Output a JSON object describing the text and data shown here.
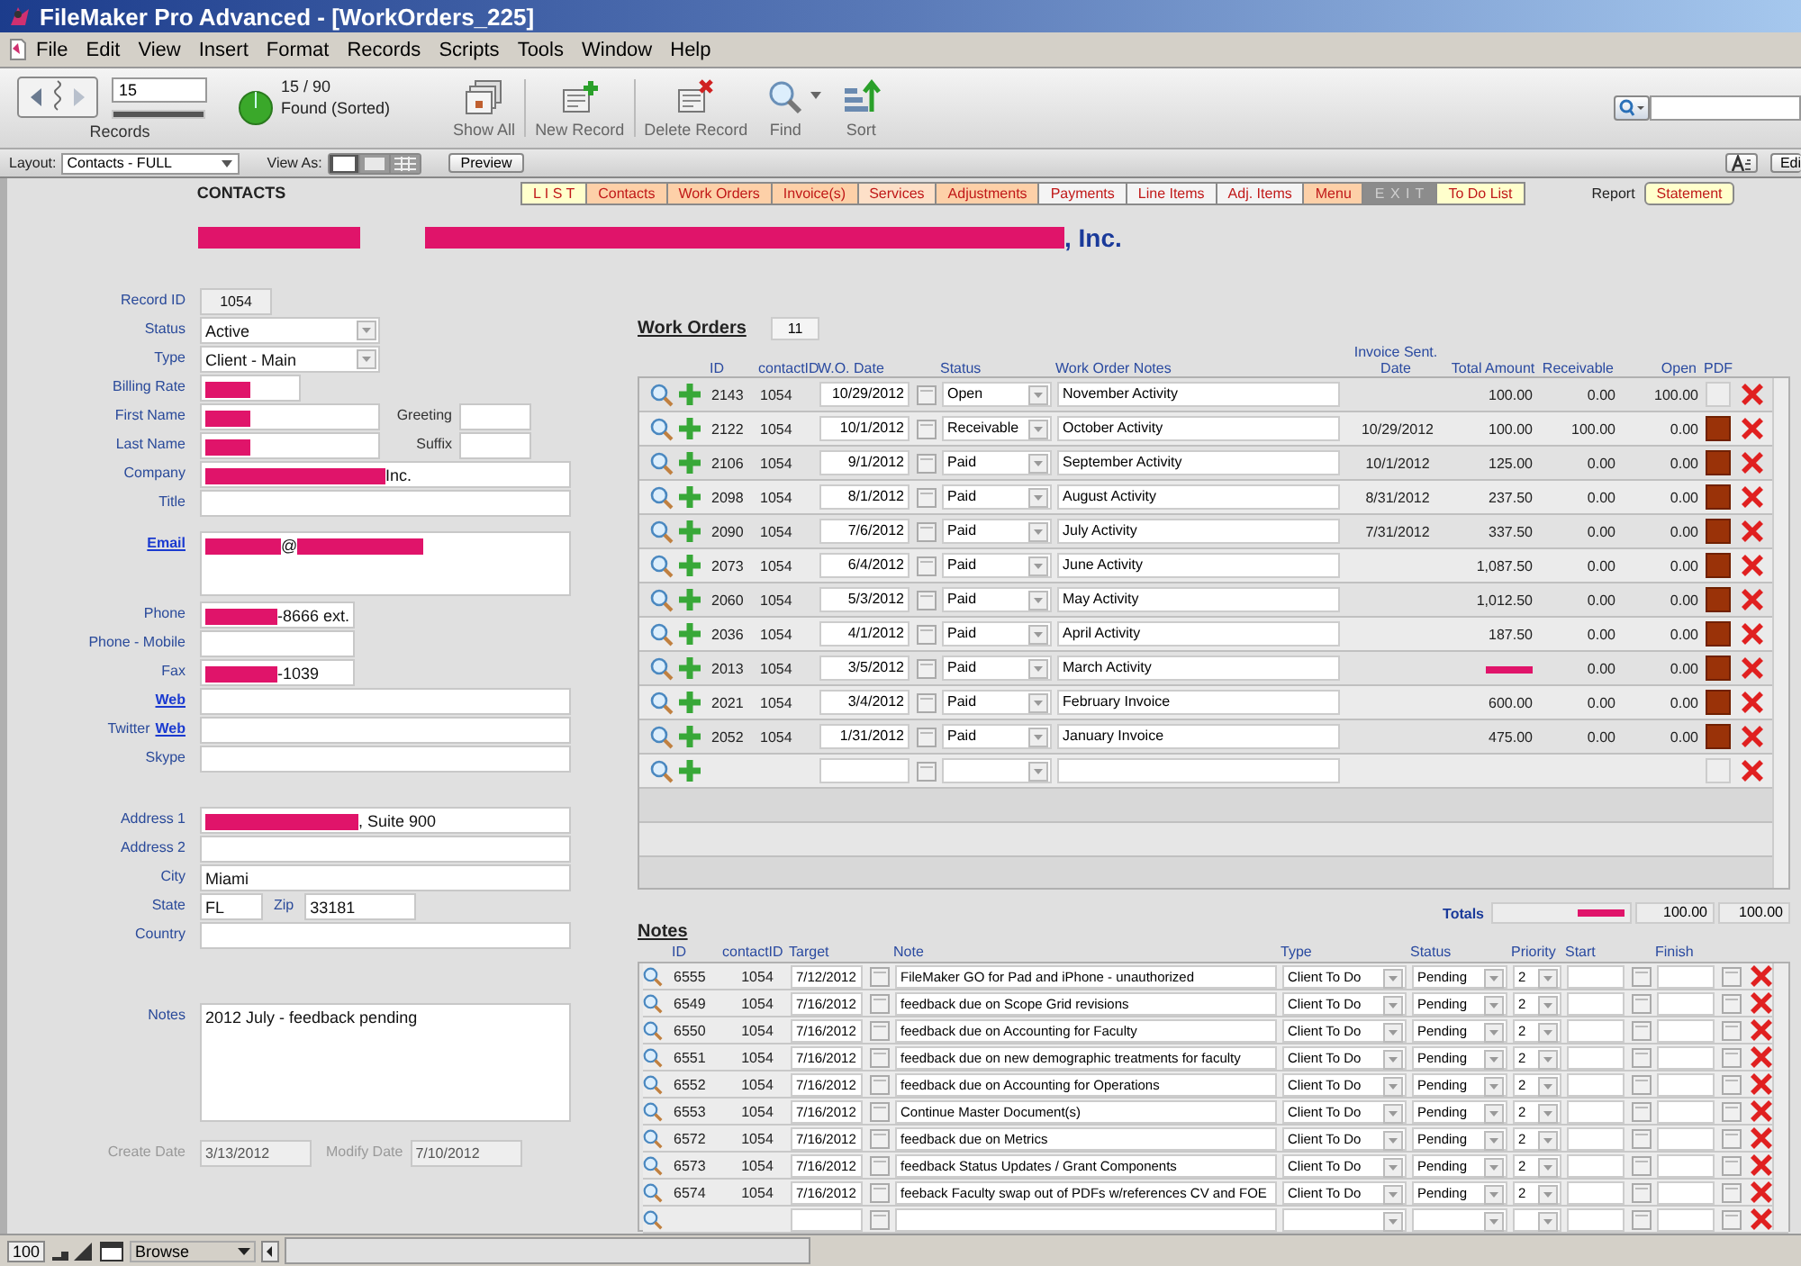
{
  "window": {
    "title": "FileMaker Pro Advanced - [WorkOrders_225]"
  },
  "menu": [
    "File",
    "Edit",
    "View",
    "Insert",
    "Format",
    "Records",
    "Scripts",
    "Tools",
    "Window",
    "Help"
  ],
  "toolbar": {
    "record_number": "15",
    "record_slider": {
      "level": 1
    },
    "records_label": "Records",
    "found_count": "15 / 90",
    "found_state": "Found (Sorted)",
    "buttons": [
      {
        "label": "Show All",
        "kind": "showall"
      },
      {
        "label": "New Record",
        "kind": "new"
      },
      {
        "label": "Delete Record",
        "kind": "delete"
      },
      {
        "label": "Find",
        "kind": "find"
      },
      {
        "label": "Sort",
        "kind": "sort"
      }
    ]
  },
  "layout_bar": {
    "layout_label": "Layout:",
    "layout": "Contacts - FULL",
    "view_as_label": "View As:",
    "view_modes": [
      {
        "kind": "form",
        "selected": true
      },
      {
        "kind": "list",
        "selected": false
      },
      {
        "kind": "table",
        "selected": false
      }
    ],
    "preview": "Preview",
    "edit_button": "Edi"
  },
  "nav": {
    "heading": "CONTACTS",
    "tabs": [
      {
        "label": "L I S T",
        "color": "#ffffcc",
        "disabled": false
      },
      {
        "label": "Contacts",
        "color": "#fdd0a8",
        "disabled": false
      },
      {
        "label": "Work Orders",
        "color": "#fdd0a8",
        "disabled": false
      },
      {
        "label": "Invoice(s)",
        "color": "#fdd0a8",
        "disabled": false
      },
      {
        "label": "Services",
        "color": "#fde0c8",
        "disabled": false
      },
      {
        "label": "Adjustments",
        "color": "#fdd0a8",
        "disabled": false
      },
      {
        "label": "Payments",
        "color": "#f4f4f4",
        "disabled": false
      },
      {
        "label": "Line Items",
        "color": "#f4f4f4",
        "disabled": false
      },
      {
        "label": "Adj. Items",
        "color": "#f4f4f4",
        "disabled": false
      },
      {
        "label": "Menu",
        "color": "#fdd0a8",
        "disabled": false
      },
      {
        "label": "E X I T",
        "color": "#8c8c8c",
        "disabled": true
      },
      {
        "label": "To Do List",
        "color": "#ffffcc",
        "disabled": false
      }
    ],
    "report_label": "Report",
    "report_tab": {
      "label": "Statement",
      "color": "#ffffcc"
    }
  },
  "record_header": {
    "name_redacted": true,
    "suffix": ", Inc."
  },
  "form": {
    "groups": [
      [
        {
          "label": "Record ID",
          "kind": "id",
          "value": "1054",
          "redacted": false
        },
        {
          "label": "Status",
          "kind": "dropdown",
          "value": "Active",
          "redacted": false
        },
        {
          "label": "Type",
          "kind": "dropdown",
          "value": "Client - Main",
          "redacted": false
        },
        {
          "label": "Billing Rate",
          "kind": "short",
          "redacted": true
        },
        {
          "label": "First Name",
          "kind": "medium",
          "redacted": true,
          "extra": {
            "label": "Greeting"
          }
        },
        {
          "label": "Last Name",
          "kind": "medium",
          "redacted": true,
          "extra": {
            "label": "Suffix"
          }
        },
        {
          "label": "Company",
          "kind": "wide",
          "redacted": true,
          "value": "Inc."
        },
        {
          "label": "Title",
          "kind": "wide",
          "redacted": false
        },
        {
          "link": "Email",
          "kind": "memo",
          "redacted": true,
          "value": "@",
          "redacted_after": true
        },
        {
          "label": "Phone",
          "kind": "phone",
          "redacted": true,
          "value": "-8666 ext."
        },
        {
          "label": "Phone - Mobile",
          "kind": "phone",
          "redacted": false
        },
        {
          "label": "Fax",
          "kind": "phone",
          "redacted": true,
          "value": "-1039"
        },
        {
          "link": "Web",
          "kind": "wide",
          "redacted": false
        },
        {
          "label": "Twitter",
          "link": "Web",
          "kind": "wide",
          "redacted": false
        },
        {
          "label": "Skype",
          "kind": "wide",
          "redacted": false
        }
      ],
      [
        {
          "label": "Address 1",
          "kind": "wide",
          "redacted": true,
          "value": ", Suite 900"
        },
        {
          "label": "Address 2",
          "kind": "wide",
          "redacted": false
        },
        {
          "label": "City",
          "kind": "wide",
          "value": "Miami",
          "redacted": false
        },
        {
          "label": "State",
          "kind": "state",
          "value": "FL",
          "redacted": false,
          "extra": {
            "label": "Zip",
            "value": "33181"
          }
        },
        {
          "label": "Country",
          "kind": "wide",
          "redacted": false
        }
      ],
      [
        {
          "label": "Notes",
          "kind": "notes",
          "value": "2012 July - feedback pending",
          "redacted": false
        }
      ],
      [
        {
          "label": "Create Date",
          "kind": "date",
          "value": "3/13/2012",
          "redacted": false,
          "extra": {
            "label": "Modify Date",
            "value": "7/10/2012"
          }
        }
      ]
    ]
  },
  "work_orders": {
    "title": "Work Orders",
    "count": "11",
    "columns": [
      "ID",
      "contactID",
      "W.O. Date",
      "Status",
      "Work Order Notes",
      "Invoice Sent. Date",
      "Total Amount",
      "Receivable",
      "Open",
      "PDF"
    ],
    "rows": [
      {
        "id": "2143",
        "contact": "1054",
        "date": "10/29/2012",
        "status": "Open",
        "notes": "November Activity",
        "total": "100.00",
        "total_redacted": false,
        "receivable": "0.00",
        "open": "100.00",
        "pdf": false
      },
      {
        "id": "2122",
        "contact": "1054",
        "date": "10/1/2012",
        "status": "Receivable",
        "notes": "October Activity",
        "sent": "10/29/2012",
        "total": "100.00",
        "total_redacted": false,
        "receivable": "100.00",
        "open": "0.00",
        "pdf": true
      },
      {
        "id": "2106",
        "contact": "1054",
        "date": "9/1/2012",
        "status": "Paid",
        "notes": "September Activity",
        "sent": "10/1/2012",
        "total": "125.00",
        "total_redacted": false,
        "receivable": "0.00",
        "open": "0.00",
        "pdf": true
      },
      {
        "id": "2098",
        "contact": "1054",
        "date": "8/1/2012",
        "status": "Paid",
        "notes": "August Activity",
        "sent": "8/31/2012",
        "total": "237.50",
        "total_redacted": false,
        "receivable": "0.00",
        "open": "0.00",
        "pdf": true
      },
      {
        "id": "2090",
        "contact": "1054",
        "date": "7/6/2012",
        "status": "Paid",
        "notes": "July Activity",
        "sent": "7/31/2012",
        "total": "337.50",
        "total_redacted": false,
        "receivable": "0.00",
        "open": "0.00",
        "pdf": true
      },
      {
        "id": "2073",
        "contact": "1054",
        "date": "6/4/2012",
        "status": "Paid",
        "notes": "June Activity",
        "total": "1,087.50",
        "total_redacted": false,
        "receivable": "0.00",
        "open": "0.00",
        "pdf": true
      },
      {
        "id": "2060",
        "contact": "1054",
        "date": "5/3/2012",
        "status": "Paid",
        "notes": "May Activity",
        "total": "1,012.50",
        "total_redacted": false,
        "receivable": "0.00",
        "open": "0.00",
        "pdf": true
      },
      {
        "id": "2036",
        "contact": "1054",
        "date": "4/1/2012",
        "status": "Paid",
        "notes": "April Activity",
        "total": "187.50",
        "total_redacted": false,
        "receivable": "0.00",
        "open": "0.00",
        "pdf": true
      },
      {
        "id": "2013",
        "contact": "1054",
        "date": "3/5/2012",
        "status": "Paid",
        "notes": "March Activity",
        "total_redacted": true,
        "receivable": "0.00",
        "open": "0.00",
        "pdf": true
      },
      {
        "id": "2021",
        "contact": "1054",
        "date": "3/4/2012",
        "status": "Paid",
        "notes": "February Invoice",
        "total": "600.00",
        "total_redacted": false,
        "receivable": "0.00",
        "open": "0.00",
        "pdf": true
      },
      {
        "id": "2052",
        "contact": "1054",
        "date": "1/31/2012",
        "status": "Paid",
        "notes": "January Invoice",
        "total": "475.00",
        "total_redacted": false,
        "receivable": "0.00",
        "open": "0.00",
        "pdf": true
      }
    ],
    "totals": {
      "label": "Totals",
      "total_redacted": true,
      "receivable": "100.00",
      "open": "100.00"
    }
  },
  "notes": {
    "title": "Notes",
    "columns": [
      "ID",
      "contactID",
      "Target",
      "Note",
      "Type",
      "Status",
      "Priority",
      "Start",
      "Finish"
    ],
    "rows": [
      {
        "id": "6555",
        "contact": "1054",
        "target": "7/12/2012",
        "note": "FileMaker GO for Pad and iPhone - unauthorized",
        "type": "Client To Do",
        "status": "Pending",
        "priority": "2"
      },
      {
        "id": "6549",
        "contact": "1054",
        "target": "7/16/2012",
        "note": "feedback due on Scope Grid revisions",
        "type": "Client To Do",
        "status": "Pending",
        "priority": "2"
      },
      {
        "id": "6550",
        "contact": "1054",
        "target": "7/16/2012",
        "note": "feedback due on Accounting for Faculty",
        "type": "Client To Do",
        "status": "Pending",
        "priority": "2"
      },
      {
        "id": "6551",
        "contact": "1054",
        "target": "7/16/2012",
        "note": "feedback due on new demographic treatments for faculty",
        "type": "Client To Do",
        "status": "Pending",
        "priority": "2"
      },
      {
        "id": "6552",
        "contact": "1054",
        "target": "7/16/2012",
        "note": "feedback due on Accounting for Operations",
        "type": "Client To Do",
        "status": "Pending",
        "priority": "2"
      },
      {
        "id": "6553",
        "contact": "1054",
        "target": "7/16/2012",
        "note": "Continue Master Document(s)",
        "type": "Client To Do",
        "status": "Pending",
        "priority": "2"
      },
      {
        "id": "6572",
        "contact": "1054",
        "target": "7/16/2012",
        "note": "feedback due on Metrics",
        "type": "Client To Do",
        "status": "Pending",
        "priority": "2"
      },
      {
        "id": "6573",
        "contact": "1054",
        "target": "7/16/2012",
        "note": "feedback Status Updates / Grant Components",
        "type": "Client To Do",
        "status": "Pending",
        "priority": "2"
      },
      {
        "id": "6574",
        "contact": "1054",
        "target": "7/16/2012",
        "note": "feeback Faculty swap out of PDFs w/references CV and FOE",
        "type": "Client To Do",
        "status": "Pending",
        "priority": "2"
      }
    ]
  },
  "status_bar": {
    "zoom": "100",
    "mode": "Browse"
  }
}
